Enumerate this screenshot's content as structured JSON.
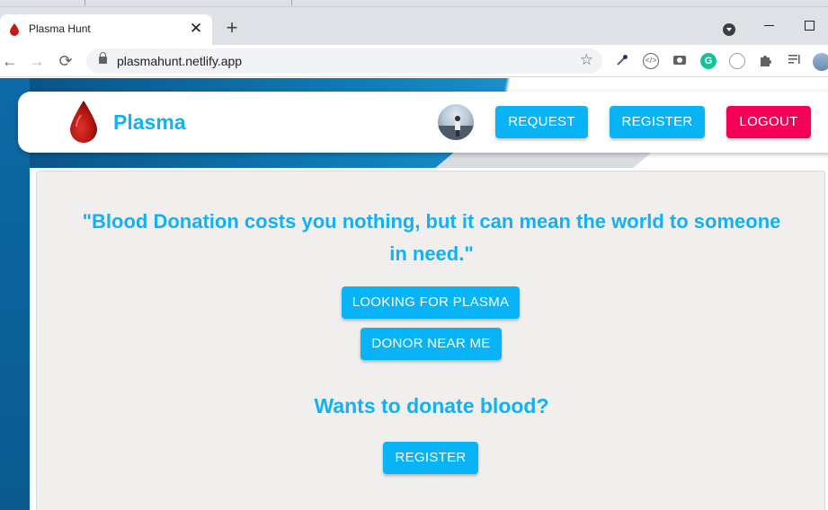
{
  "browser": {
    "tab_title": "Plasma Hunt",
    "tab_close": "✕",
    "new_tab": "+",
    "url": "plasmahunt.netlify.app",
    "back": "←",
    "forward": "→",
    "reload": "⟳",
    "star": "☆"
  },
  "navbar": {
    "brand": "Plasma",
    "buttons": {
      "request": "REQUEST",
      "register": "REGISTER",
      "logout": "LOGOUT"
    }
  },
  "hero": {
    "quote": "\"Blood Donation costs you nothing, but it can mean the world to someone in need.\"",
    "looking_button": "LOOKING FOR PLASMA",
    "donor_button": "DONOR NEAR ME",
    "donate_heading": "Wants to donate blood?",
    "register_button": "REGISTER"
  },
  "colors": {
    "accent": "#12b1f1",
    "button_blue": "#08b4f5",
    "logout_pink": "#f50057",
    "card_bg": "#f0efee"
  }
}
